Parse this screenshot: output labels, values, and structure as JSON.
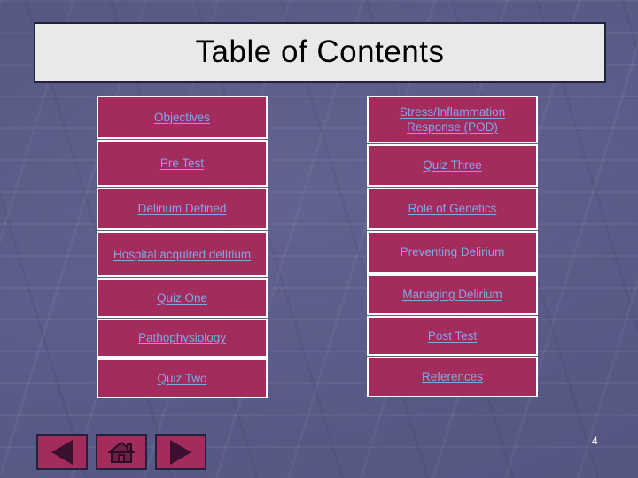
{
  "slide": {
    "title": "Table of Contents",
    "page_number": "4",
    "colors": {
      "background": "#5b5b89",
      "title_box": "#e9e9e9",
      "title_text": "#000000",
      "button_fill": "#a42c5c",
      "button_border": "#ffffff",
      "link_text": "#7fa8e8",
      "nav_border": "#22223f",
      "nav_glyph": "#3a1030",
      "page_number": "#ffffff"
    }
  },
  "toc": {
    "left_column": [
      {
        "label": "Objectives"
      },
      {
        "label": "Pre Test"
      },
      {
        "label": "Delirium Defined"
      },
      {
        "label": "Hospital acquired delirium"
      },
      {
        "label": "Quiz One"
      },
      {
        "label": "Pathophysiology"
      },
      {
        "label": "Quiz Two"
      }
    ],
    "right_column": [
      {
        "label": "Stress/Inflammation Response (POD)"
      },
      {
        "label": "Quiz Three"
      },
      {
        "label": "Role of Genetics"
      },
      {
        "label": "Preventing Delirium"
      },
      {
        "label": "Managing Delirium"
      },
      {
        "label": "Post Test"
      },
      {
        "label": "References"
      }
    ]
  },
  "navigation": {
    "back": {
      "label": "Back",
      "icon": "triangle-left-icon"
    },
    "home": {
      "label": "Home",
      "icon": "home-icon"
    },
    "forward": {
      "label": "Forward",
      "icon": "triangle-right-icon"
    }
  }
}
